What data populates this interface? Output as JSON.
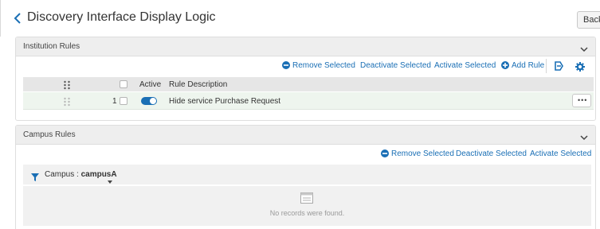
{
  "page": {
    "title": "Discovery Interface Display Logic",
    "back_label": "Back"
  },
  "institution_rules": {
    "title": "Institution Rules",
    "actions": {
      "remove": "Remove Selected",
      "deactivate": "Deactivate Selected",
      "activate": "Activate Selected",
      "add": "Add Rule"
    },
    "columns": {
      "active": "Active",
      "rule_description": "Rule Description"
    },
    "rows": [
      {
        "number": "1",
        "active": true,
        "description": "Hide service Purchase Request",
        "more": "•••"
      }
    ]
  },
  "campus_rules": {
    "title": "Campus Rules",
    "actions": {
      "remove": "Remove Selected",
      "deactivate": "Deactivate Selected",
      "activate": "Activate Selected"
    },
    "filter": {
      "label": "Campus :",
      "value": "campusA"
    },
    "empty_message": "No records were found."
  },
  "colors": {
    "accent": "#1a6fb5",
    "header_bg": "#eeeeee",
    "row_bg": "#eef5ee"
  },
  "icons": [
    "back-chevron-icon",
    "collapse-chevron-icon",
    "remove-circle-icon",
    "add-circle-icon",
    "export-icon",
    "settings-gear-icon",
    "drag-handle-icon",
    "filter-funnel-icon",
    "dropdown-caret-icon",
    "empty-list-icon"
  ]
}
